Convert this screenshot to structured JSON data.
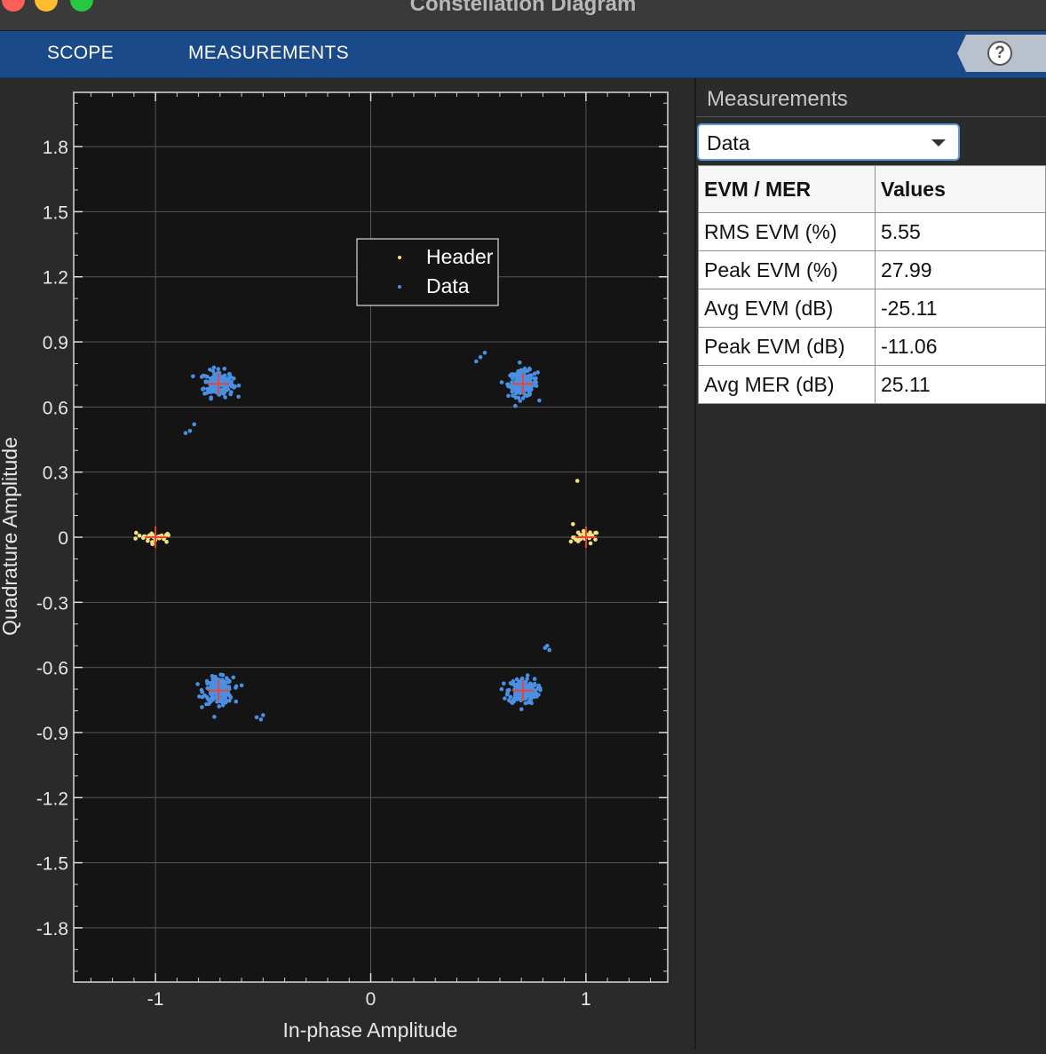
{
  "window": {
    "title": "Constellation Diagram"
  },
  "toolstrip": {
    "tabs": [
      {
        "label": "SCOPE"
      },
      {
        "label": "MEASUREMENTS"
      }
    ],
    "help_icon": "question-mark-icon"
  },
  "colors": {
    "header": "#f7e27a",
    "data": "#4a90e2",
    "reference": "#e8453c",
    "toolstrip": "#1b4a8a",
    "plot_bg": "#141414"
  },
  "chart_data": {
    "type": "scatter",
    "xlabel": "In-phase Amplitude",
    "ylabel": "Quadrature Amplitude",
    "xlim": [
      -1.38,
      1.38
    ],
    "ylim": [
      -2.05,
      2.05
    ],
    "xticks": [
      {
        "v": -1,
        "label": "-1"
      },
      {
        "v": 0,
        "label": "0"
      },
      {
        "v": 1,
        "label": "1"
      }
    ],
    "yticks": [
      {
        "v": 1.8,
        "label": "1.8"
      },
      {
        "v": 1.5,
        "label": "1.5"
      },
      {
        "v": 1.2,
        "label": "1.2"
      },
      {
        "v": 0.9,
        "label": "0.9"
      },
      {
        "v": 0.6,
        "label": "0.6"
      },
      {
        "v": 0.3,
        "label": "0.3"
      },
      {
        "v": 0,
        "label": "0"
      },
      {
        "v": -0.3,
        "label": "-0.3"
      },
      {
        "v": -0.6,
        "label": "-0.6"
      },
      {
        "v": -0.9,
        "label": "-0.9"
      },
      {
        "v": -1.2,
        "label": "-1.2"
      },
      {
        "v": -1.5,
        "label": "-1.5"
      },
      {
        "v": -1.8,
        "label": "-1.8"
      }
    ],
    "grid": true,
    "legend_position": "top-center",
    "reference_points": [
      [
        -1,
        0
      ],
      [
        1,
        0
      ],
      [
        -0.707,
        0.707
      ],
      [
        0.707,
        0.707
      ],
      [
        -0.707,
        -0.707
      ],
      [
        0.707,
        -0.707
      ]
    ],
    "series": [
      {
        "name": "Header",
        "clusters": [
          {
            "center": [
              -1,
              0
            ],
            "spread": [
              0.045,
              0.012
            ],
            "n": 25
          },
          {
            "center": [
              1,
              0
            ],
            "spread": [
              0.03,
              0.014
            ],
            "n": 25
          }
        ],
        "points": [
          [
            0.96,
            0.26
          ],
          [
            0.94,
            0.06
          ],
          [
            0.93,
            -0.02
          ],
          [
            -1.09,
            0.02
          ],
          [
            -0.94,
            0.01
          ]
        ]
      },
      {
        "name": "Data",
        "clusters": [
          {
            "center": [
              -0.707,
              0.707
            ],
            "spread": [
              0.034,
              0.03
            ],
            "n": 180
          },
          {
            "center": [
              0.707,
              0.707
            ],
            "spread": [
              0.034,
              0.03
            ],
            "n": 180
          },
          {
            "center": [
              -0.707,
              -0.707
            ],
            "spread": [
              0.034,
              0.03
            ],
            "n": 180
          },
          {
            "center": [
              0.707,
              -0.707
            ],
            "spread": [
              0.034,
              0.03
            ],
            "n": 180
          }
        ],
        "points": [
          [
            -0.82,
            0.52
          ],
          [
            -0.84,
            0.49
          ],
          [
            -0.86,
            0.48
          ],
          [
            0.53,
            0.85
          ],
          [
            0.51,
            0.83
          ],
          [
            0.49,
            0.81
          ],
          [
            -0.5,
            -0.82
          ],
          [
            -0.51,
            -0.84
          ],
          [
            -0.53,
            -0.83
          ],
          [
            0.82,
            -0.5
          ],
          [
            0.83,
            -0.52
          ],
          [
            0.81,
            -0.51
          ]
        ]
      }
    ]
  },
  "measurements": {
    "title": "Measurements",
    "selector": {
      "value": "Data"
    },
    "table": {
      "headers": [
        "EVM / MER",
        "Values"
      ],
      "rows": [
        {
          "label": "RMS EVM (%)",
          "value": "5.55"
        },
        {
          "label": "Peak EVM (%)",
          "value": "27.99"
        },
        {
          "label": "Avg EVM (dB)",
          "value": "-25.11"
        },
        {
          "label": "Peak EVM (dB)",
          "value": "-11.06"
        },
        {
          "label": "Avg MER (dB)",
          "value": "25.11"
        }
      ]
    }
  }
}
